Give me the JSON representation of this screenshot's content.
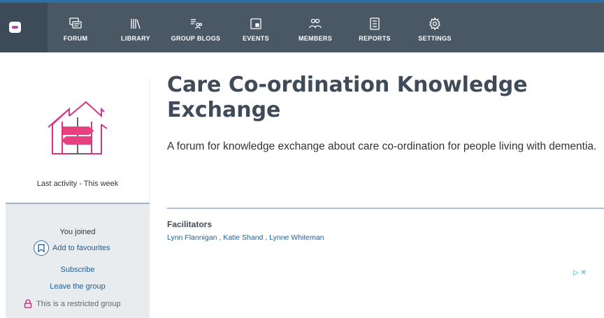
{
  "nav": {
    "items": [
      {
        "label": "FORUM",
        "icon": "forum-icon"
      },
      {
        "label": "LIBRARY",
        "icon": "library-icon"
      },
      {
        "label": "GROUP BLOGS",
        "icon": "group-blogs-icon"
      },
      {
        "label": "EVENTS",
        "icon": "events-icon"
      },
      {
        "label": "MEMBERS",
        "icon": "members-icon"
      },
      {
        "label": "REPORTS",
        "icon": "reports-icon"
      },
      {
        "label": "SETTINGS",
        "icon": "settings-icon"
      }
    ]
  },
  "sidebar": {
    "last_activity": "Last activity - This week",
    "you_joined": "You joined",
    "add_favourites": "Add to favourites",
    "subscribe": "Subscribe",
    "leave_group": "Leave the group",
    "restricted": "This is a restricted group"
  },
  "main": {
    "title": "Care Co-ordination Knowledge Exchange",
    "description": " A forum for knowledge exchange about care co-ordination for people living with dementia.",
    "facilitators_heading": "Facilitators",
    "facilitators": [
      "Lynn Flannigan",
      "Katie Shand",
      "Lynne Whiteman"
    ],
    "separator": " , "
  },
  "ad": {
    "marker": "▷ ✕"
  },
  "colors": {
    "nav_bg": "#4a5866",
    "accent_blue": "#2e6ea6",
    "brand_pink": "#d63384",
    "link": "#1f5d96"
  }
}
